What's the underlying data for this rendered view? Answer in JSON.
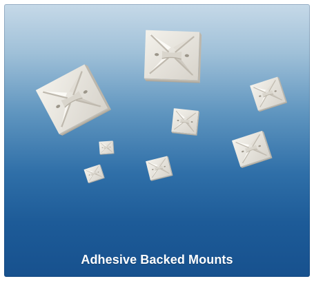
{
  "caption": "Adhesive Backed Mounts",
  "colors": {
    "background_top": "#c6d9e8",
    "background_bottom": "#17518e",
    "mount_face": "#ece9e2",
    "caption_text": "#ffffff"
  },
  "subject": {
    "object_name": "adhesive-backed-mount",
    "count": 8
  }
}
